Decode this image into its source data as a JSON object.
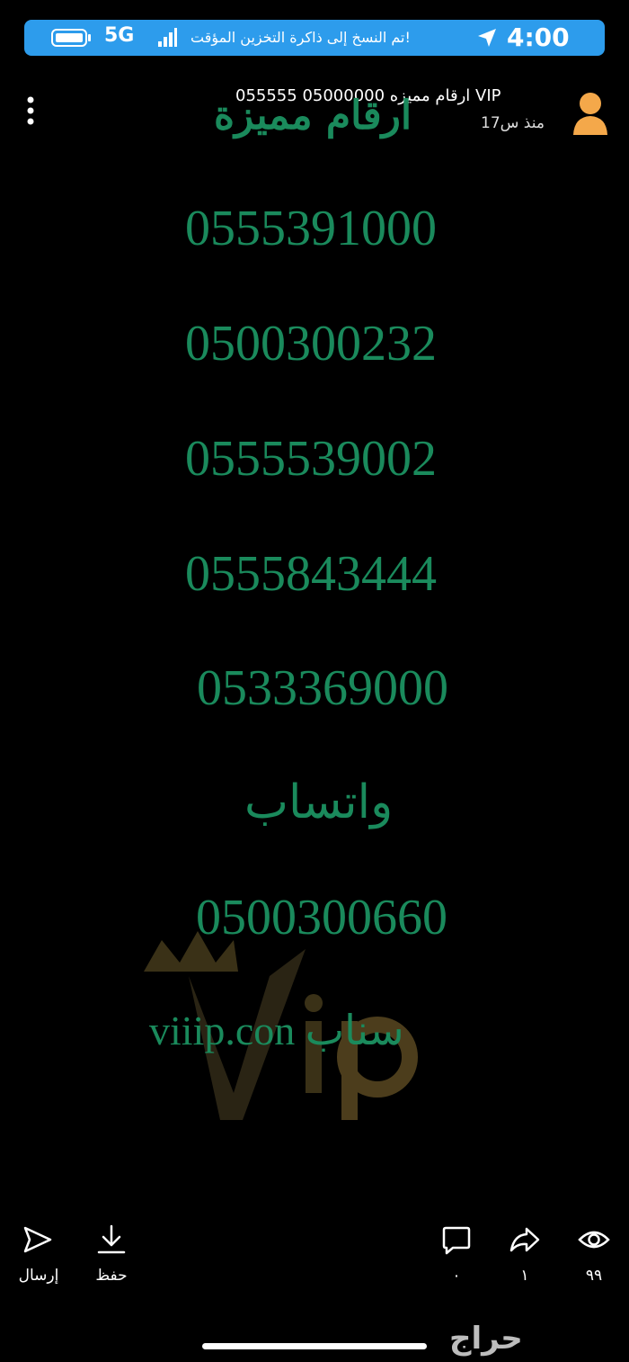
{
  "status_bar": {
    "time": "4:00",
    "network": "5G",
    "toast": "تم النسخ إلى ذاكرة التخزين المؤقت!",
    "accent_color": "#2d9cec"
  },
  "header": {
    "author": "ارقام مميزه 05000000 055555 VIP",
    "time_ago": "منذ س17"
  },
  "story": {
    "headline": "ارقام مميزة",
    "numbers": [
      "0555391000",
      "0500300232",
      "0555539002",
      "0555843444",
      "0533369000"
    ],
    "whatsapp_label": "واتساب",
    "whatsapp_number": "0500300660",
    "snap_line": "viiip.con سناب",
    "text_color": "#1a8a5c"
  },
  "bottom_bar": {
    "send_label": "إرسال",
    "save_label": "حفظ",
    "comments_count": "٠",
    "shares_count": "١",
    "views_count": "٩٩"
  },
  "branding": {
    "app_logo": "حراج"
  }
}
